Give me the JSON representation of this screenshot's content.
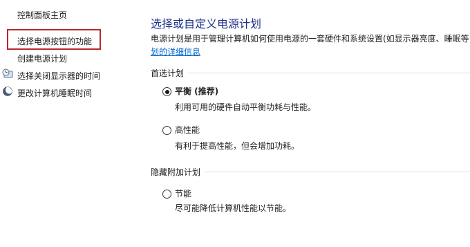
{
  "sidebar": {
    "home": "控制面板主页",
    "items": [
      {
        "label": "选择电源按钮的功能"
      },
      {
        "label": "创建电源计划"
      },
      {
        "label": "选择关闭显示器的时间",
        "icon": "monitor-clock-icon"
      },
      {
        "label": "更改计算机睡眠时间",
        "icon": "moon-icon"
      }
    ]
  },
  "main": {
    "title": "选择或自定义电源计划",
    "description": "电源计划是用于管理计算机如何使用电源的一套硬件和系统设置(如显示器亮度、睡眠等",
    "link": "划的详细信息",
    "preferred_label": "首选计划",
    "plans": [
      {
        "name": "平衡 (推荐)",
        "desc": "利用可用的硬件自动平衡功耗与性能。",
        "selected": true
      },
      {
        "name": "高性能",
        "desc": "有利于提高性能，但会增加功耗。",
        "selected": false
      }
    ],
    "hidden_label": "隐藏附加计划",
    "hidden_plans": [
      {
        "name": "节能",
        "desc": "尽可能降低计算机性能以节能。",
        "selected": false
      }
    ]
  },
  "colors": {
    "title": "#1e3287",
    "link": "#0066cc",
    "highlight": "#b8282e"
  }
}
